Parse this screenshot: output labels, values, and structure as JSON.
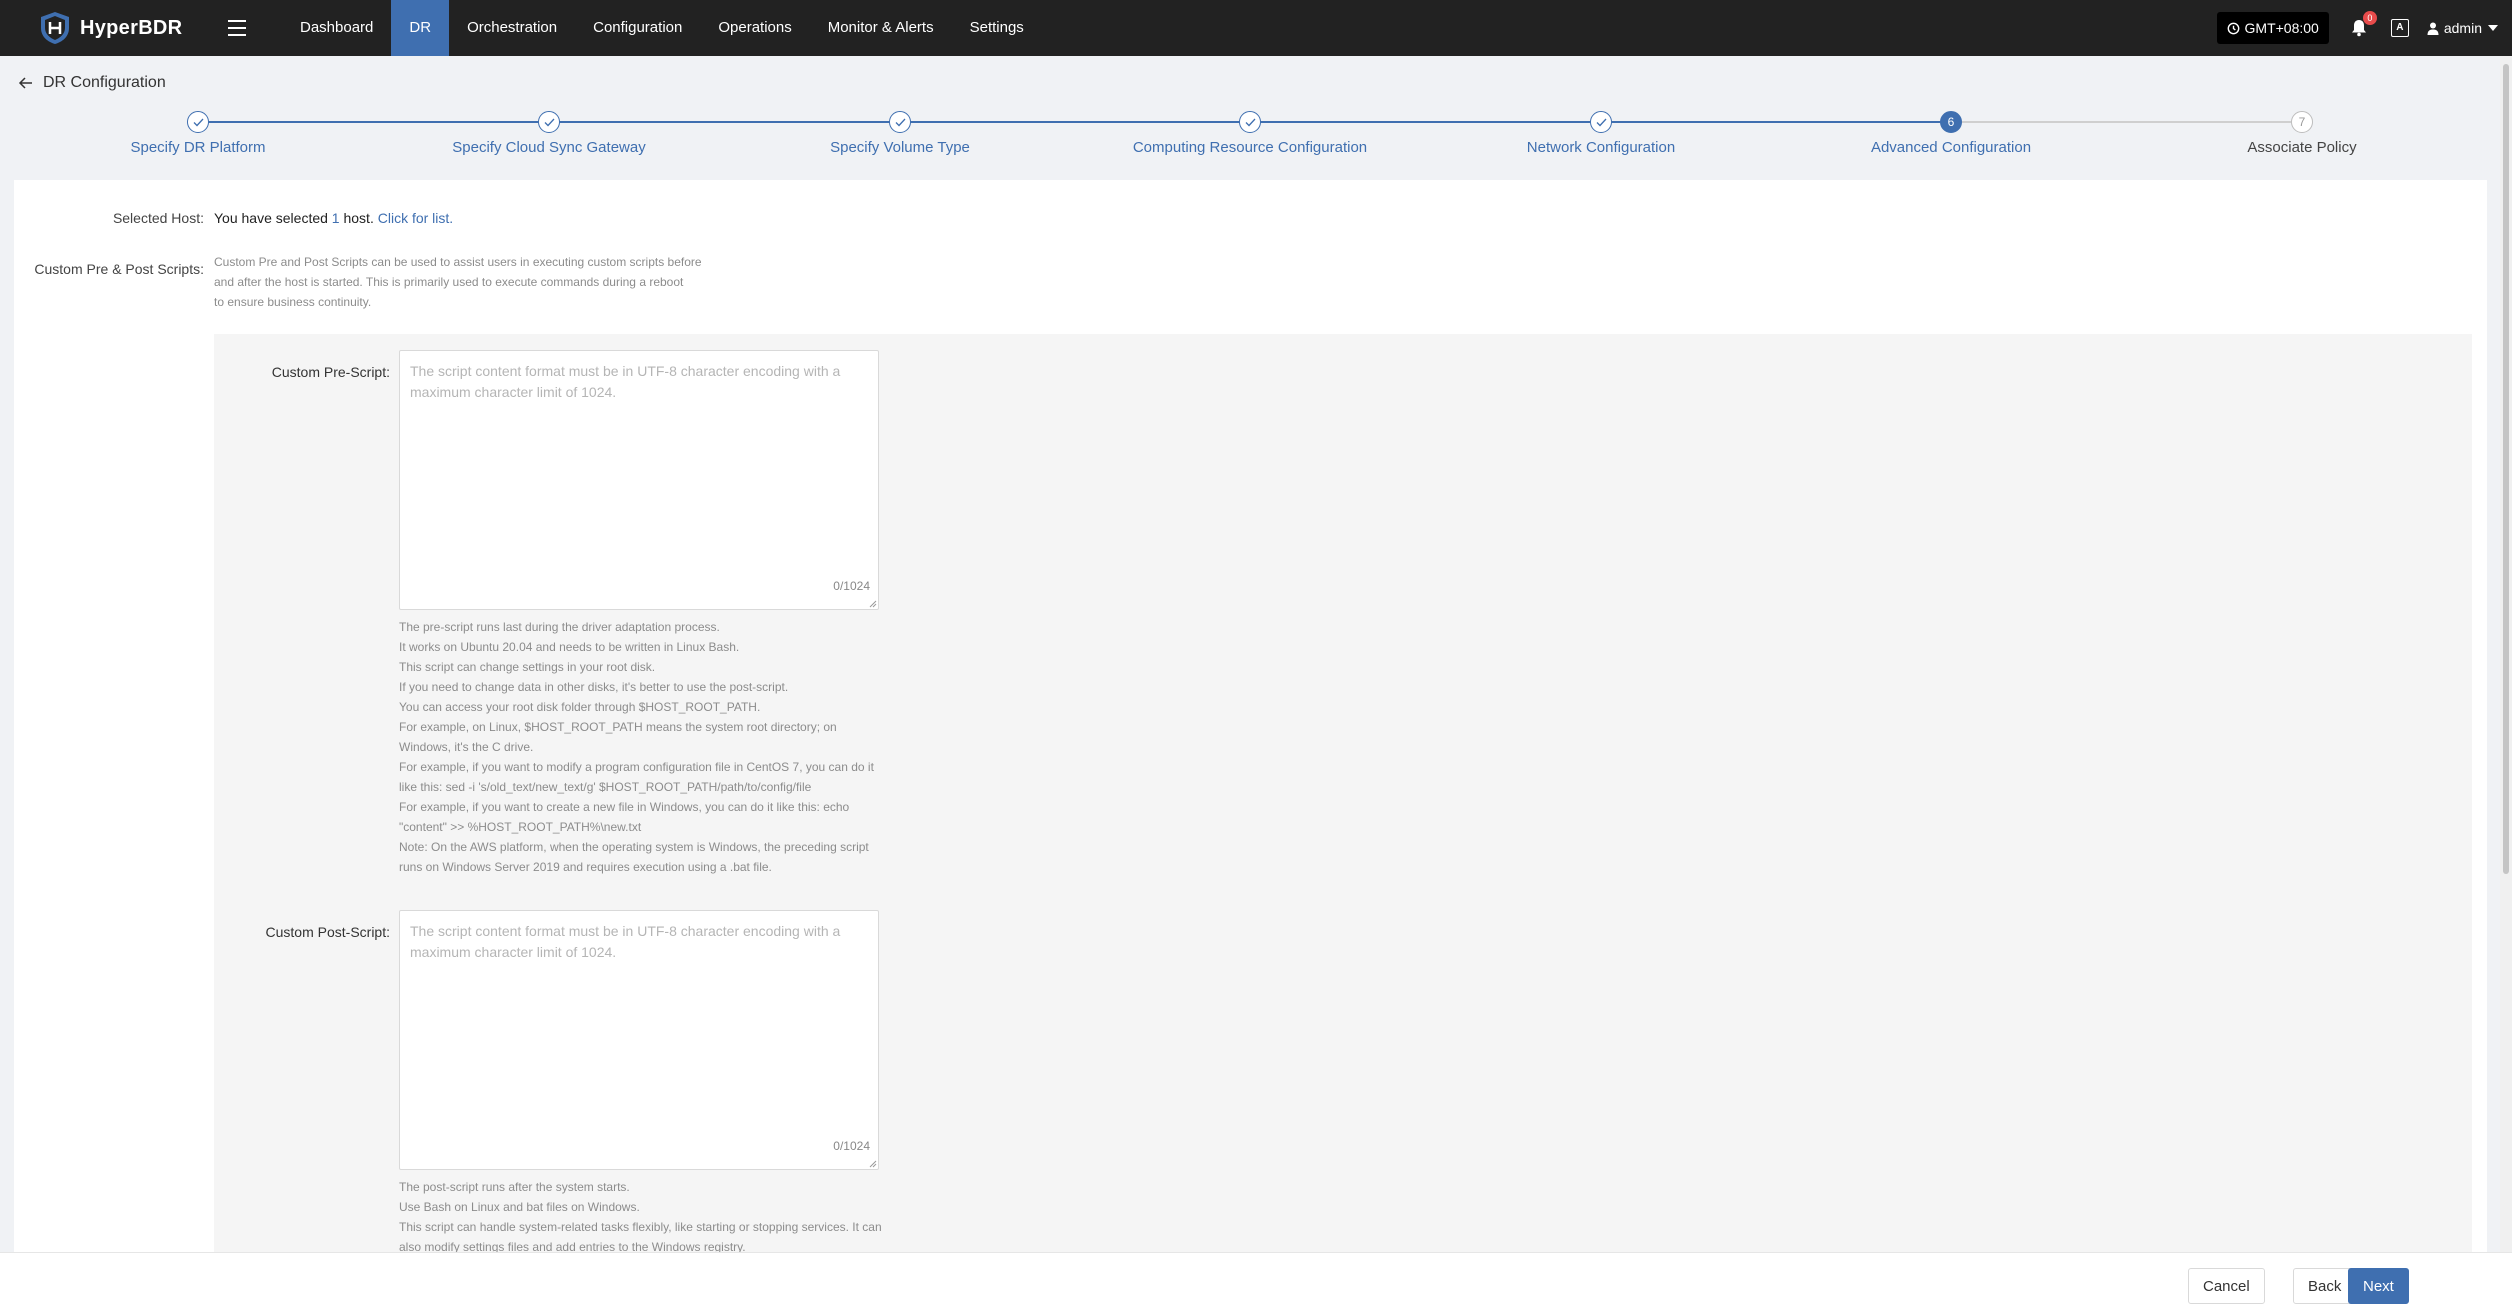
{
  "app": {
    "name": "HyperBDR",
    "brand_color": "#3f6fb0",
    "header_color": "#222222"
  },
  "nav": {
    "items": [
      {
        "label": "Dashboard",
        "active": false
      },
      {
        "label": "DR",
        "active": true
      },
      {
        "label": "Orchestration",
        "active": false
      },
      {
        "label": "Configuration",
        "active": false
      },
      {
        "label": "Operations",
        "active": false
      },
      {
        "label": "Monitor & Alerts",
        "active": false
      },
      {
        "label": "Settings",
        "active": false
      }
    ],
    "timezone": "GMT+08:00",
    "notification_count": "0",
    "lang_icon": "A",
    "user": "admin"
  },
  "page": {
    "title": "DR Configuration"
  },
  "steps": [
    {
      "label": "Specify DR Platform",
      "state": "done",
      "num": "1"
    },
    {
      "label": "Specify Cloud Sync Gateway",
      "state": "done",
      "num": "2"
    },
    {
      "label": "Specify Volume Type",
      "state": "done",
      "num": "3"
    },
    {
      "label": "Computing Resource Configuration",
      "state": "done",
      "num": "4"
    },
    {
      "label": "Network Configuration",
      "state": "done",
      "num": "5"
    },
    {
      "label": "Advanced Configuration",
      "state": "current",
      "num": "6"
    },
    {
      "label": "Associate Policy",
      "state": "pending",
      "num": "7"
    }
  ],
  "form": {
    "selected_host_label": "Selected Host:",
    "selected_host_prefix": "You have selected ",
    "selected_host_count": "1",
    "selected_host_suffix": " host.",
    "selected_host_link": "Click for list.",
    "scripts_label": "Custom Pre & Post Scripts:",
    "scripts_desc": [
      "Custom Pre and Post Scripts can be used to assist users in executing custom scripts before",
      "and after the host is started. This is primarily used to execute commands during a reboot",
      "to ensure business continuity."
    ],
    "pre_script": {
      "label": "Custom Pre-Script:",
      "placeholder": "The script content format must be in UTF-8 character encoding with a maximum character limit of 1024.",
      "value": "",
      "counter": "0/1024",
      "help": [
        "The pre-script runs last during the driver adaptation process.",
        "It works on Ubuntu 20.04 and needs to be written in Linux Bash.",
        "This script can change settings in your root disk.",
        "If you need to change data in other disks, it's better to use the post-script.",
        "You can access your root disk folder through $HOST_ROOT_PATH.",
        "For example, on Linux, $HOST_ROOT_PATH means the system root directory; on Windows, it's the C drive.",
        "For example, if you want to modify a program configuration file in CentOS 7, you can do it like this: sed -i 's/old_text/new_text/g' $HOST_ROOT_PATH/path/to/config/file",
        "For example, if you want to create a new file in Windows, you can do it like this: echo \"content\" >> %HOST_ROOT_PATH%\\new.txt",
        "Note: On the AWS platform, when the operating system is Windows, the preceding script runs on Windows Server 2019 and requires execution using a .bat file."
      ]
    },
    "post_script": {
      "label": "Custom Post-Script:",
      "placeholder": "The script content format must be in UTF-8 character encoding with a maximum character limit of 1024.",
      "value": "",
      "counter": "0/1024",
      "help": [
        "The post-script runs after the system starts.",
        "Use Bash on Linux and bat files on Windows.",
        "This script can handle system-related tasks flexibly, like starting or stopping services. It can also modify settings files and add entries to the Windows registry."
      ]
    }
  },
  "footer": {
    "cancel": "Cancel",
    "back": "Back",
    "next": "Next"
  }
}
